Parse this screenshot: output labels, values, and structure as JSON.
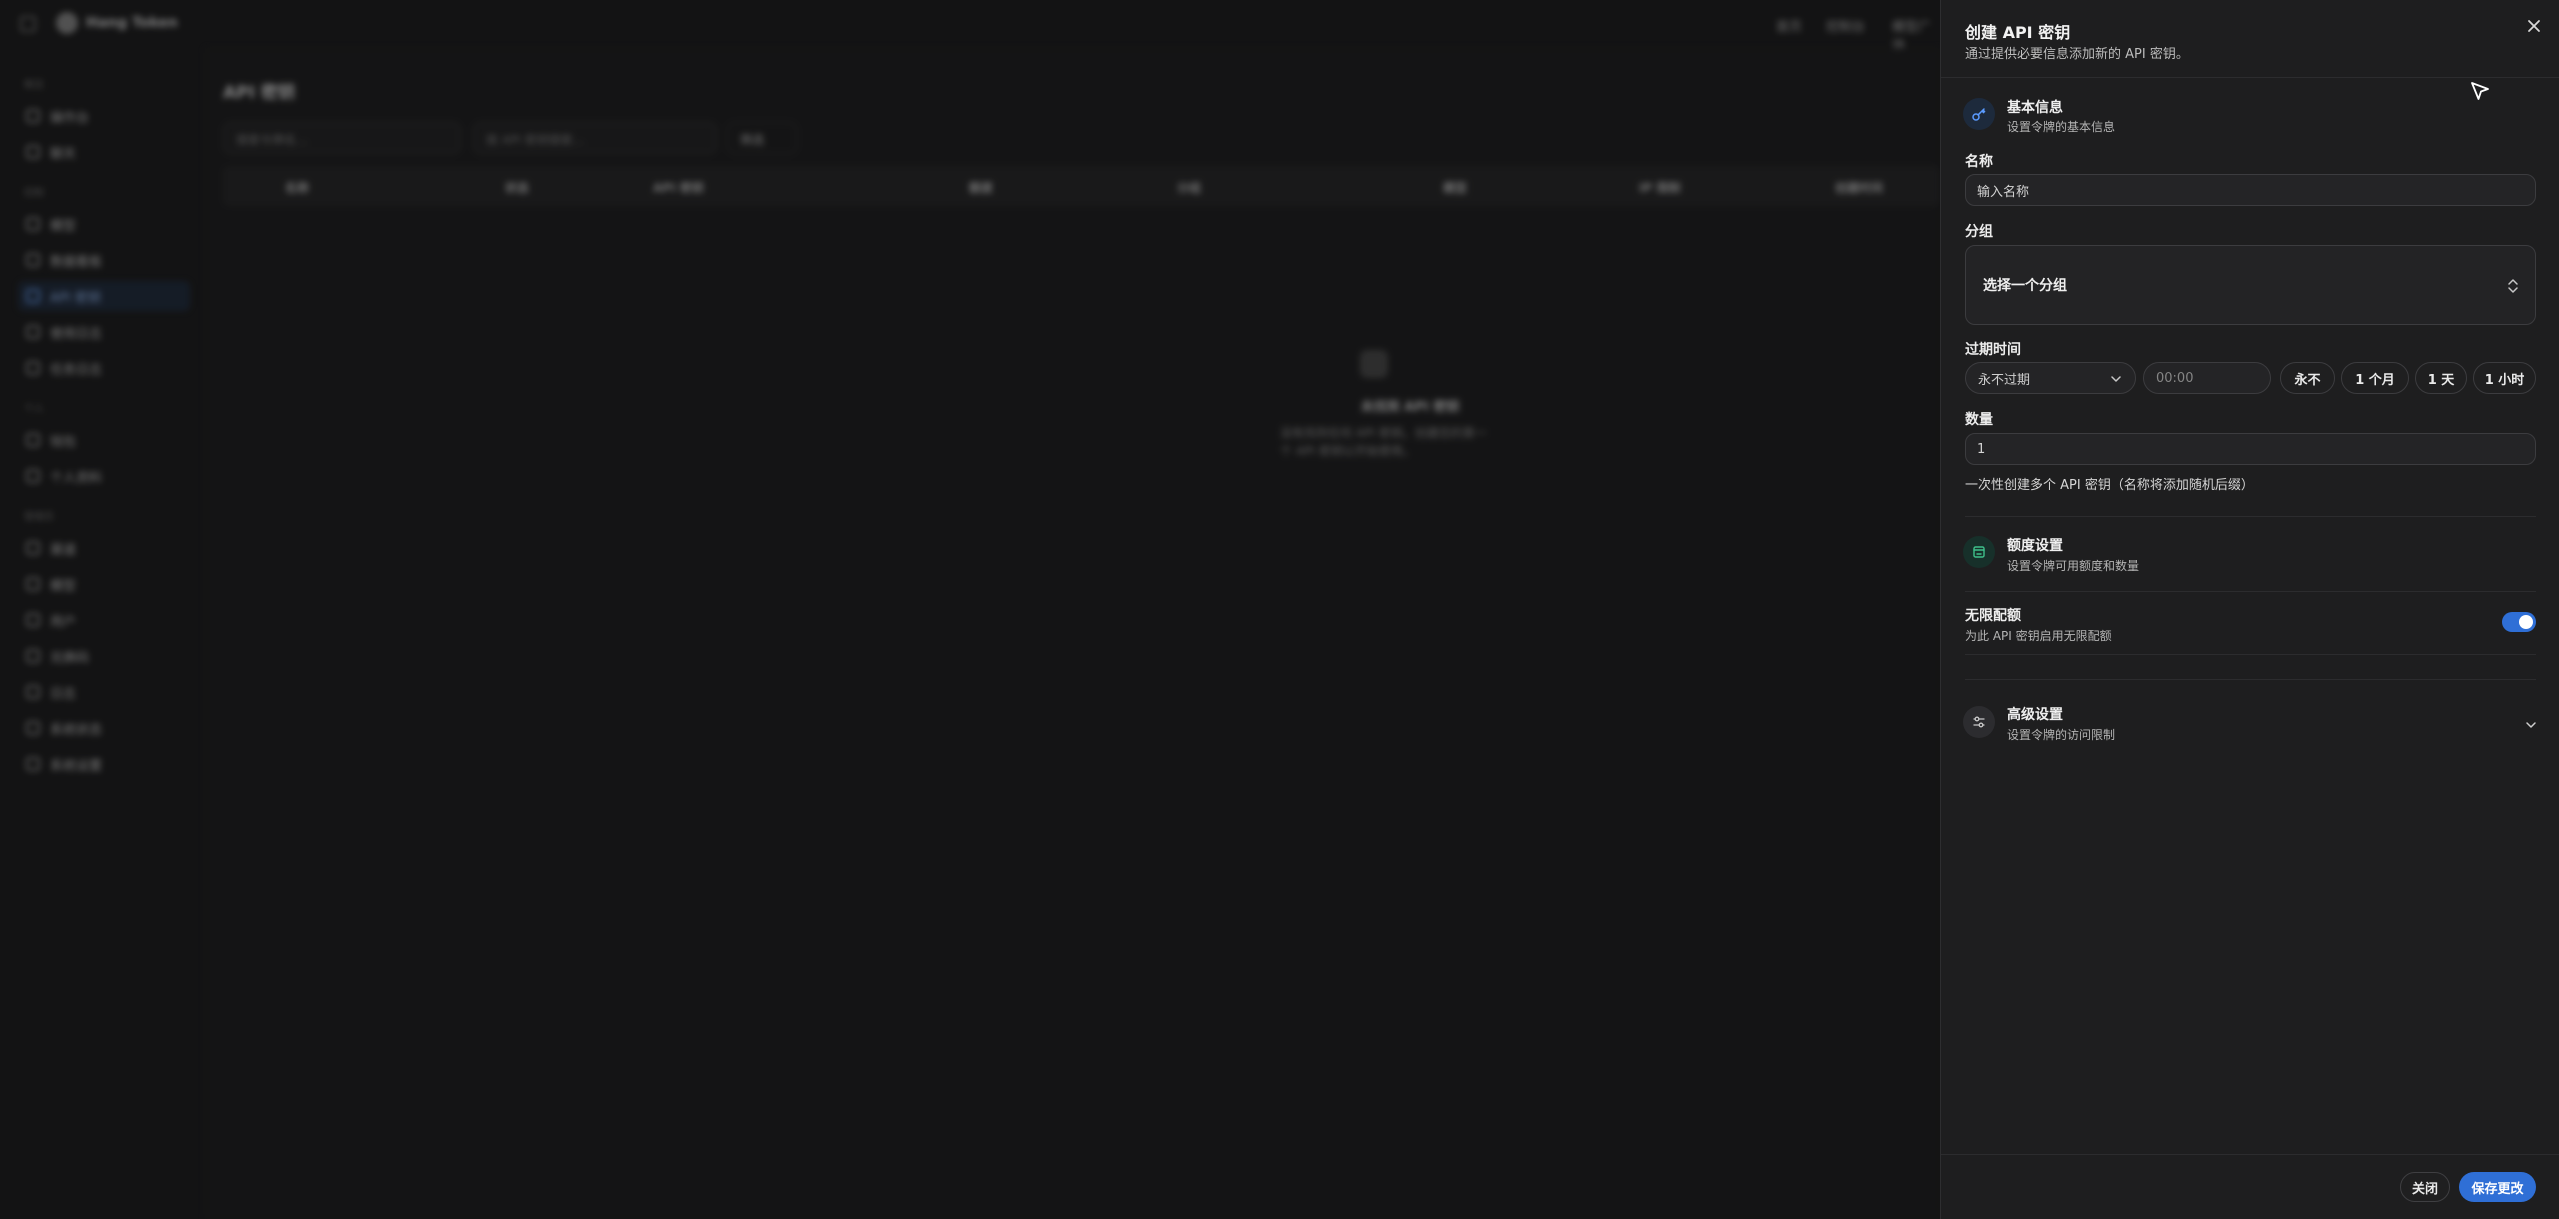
{
  "background": {
    "brand": "Hang Token",
    "top_nav": [
      "首页",
      "控制台",
      "模型广场"
    ],
    "sidebar": {
      "groups": [
        "概览",
        "控制",
        "个人",
        "管理员"
      ],
      "items": [
        "操作台",
        "聊天",
        "模型",
        "数据看板",
        "API 密钥",
        "使用日志",
        "任务日志",
        "钱包",
        "个人资料",
        "渠道",
        "模型",
        "用户",
        "兑换码",
        "日志",
        "系统状态",
        "系统设置"
      ],
      "active_item": "API 密钥"
    },
    "page_title": "API 密钥",
    "filter_placeholder_1": "搜索令牌名...",
    "filter_placeholder_2": "按 API 密钥搜索...",
    "filter_button": "筛选",
    "table_headers": [
      "名称",
      "状态",
      "API 密钥",
      "额度",
      "分组",
      "模型",
      "IP 限制",
      "创建时间"
    ],
    "empty_title": "未找到 API 密钥",
    "empty_desc": "没有找到任何 API 密钥。创建您的第一个 API 密钥以开始使用。"
  },
  "drawer": {
    "title": "创建 API 密钥",
    "description": "通过提供必要信息添加新的 API 密钥。",
    "basic": {
      "title": "基本信息",
      "subtitle": "设置令牌的基本信息",
      "icon": "key-icon",
      "name_label": "名称",
      "name_placeholder": "输入名称",
      "group_label": "分组",
      "group_placeholder": "选择一个分组",
      "expire_label": "过期时间",
      "expire_selected": "永不过期",
      "time_placeholder": "00:00",
      "quick_options": [
        "永不",
        "1 个月",
        "1 天",
        "1 小时"
      ],
      "quantity_label": "数量",
      "quantity_value": "1",
      "quantity_hint": "一次性创建多个 API 密钥（名称将添加随机后缀）"
    },
    "quota": {
      "title": "额度设置",
      "subtitle": "设置令牌可用额度和数量",
      "icon": "wallet-icon",
      "unlimited_label": "无限配额",
      "unlimited_desc": "为此 API 密钥启用无限配额",
      "unlimited_on": true
    },
    "advanced": {
      "title": "高级设置",
      "subtitle": "设置令牌的访问限制",
      "icon": "sliders-icon"
    },
    "footer": {
      "close_label": "关闭",
      "save_label": "保存更改"
    },
    "accent_color": "#2f6fd6"
  }
}
